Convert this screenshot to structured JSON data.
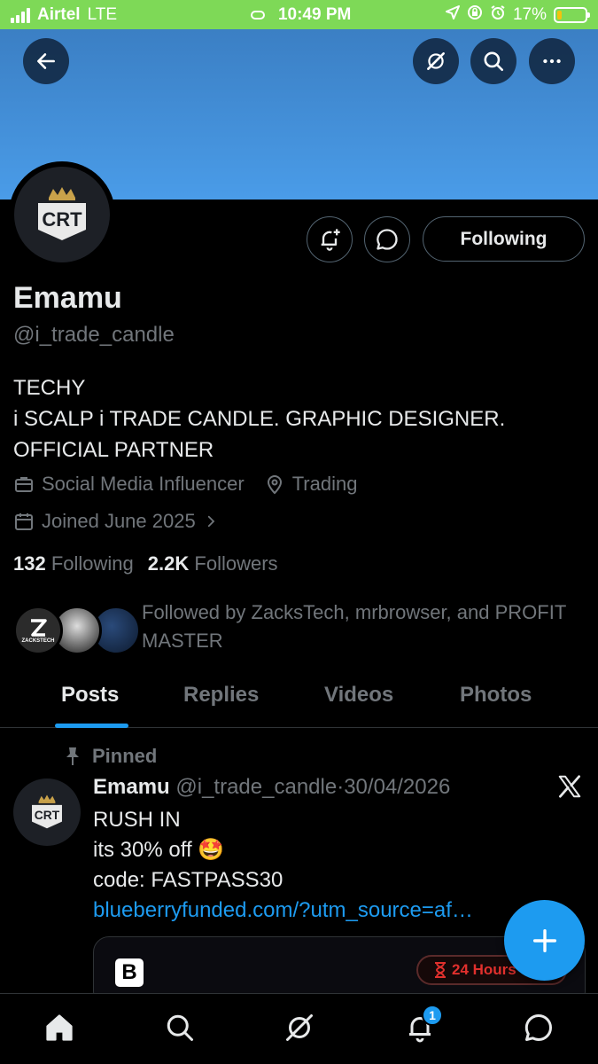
{
  "status_bar": {
    "carrier": "Airtel",
    "network": "LTE",
    "time": "10:49 PM",
    "battery_percent": "17%",
    "battery_level": 0.17,
    "background_color": "#7ed957"
  },
  "header": {
    "icons": [
      "back-arrow-icon",
      "grok-icon",
      "search-icon",
      "more-icon"
    ]
  },
  "profile": {
    "avatar_text": "CRT",
    "follow_label": "Following",
    "name": "Emamu",
    "handle": "@i_trade_candle",
    "bio_lines": [
      "TECHY",
      "i SCALP i TRADE CANDLE. GRAPHIC DESIGNER.",
      "OFFICIAL PARTNER"
    ],
    "category": "Social Media Influencer",
    "location": "Trading",
    "joined": "Joined June 2025",
    "following_count": "132",
    "following_label": "Following",
    "followers_count": "2.2K",
    "followers_label": "Followers",
    "followed_by": "Followed by ZacksTech, mrbrowser, and PROFIT MASTER",
    "followed_avatar_1_text": "ZACKSTECH"
  },
  "tabs": [
    {
      "label": "Posts",
      "active": true
    },
    {
      "label": "Replies",
      "active": false
    },
    {
      "label": "Videos",
      "active": false
    },
    {
      "label": "Photos",
      "active": false
    }
  ],
  "post": {
    "pinned_label": "Pinned",
    "author": "Emamu",
    "handle": "@i_trade_candle",
    "separator": "·",
    "date": "30/04/2026",
    "lines": [
      "RUSH IN",
      "its 30% off 🤩",
      "code: FASTPASS30"
    ],
    "link": "blueberryfunded.com/?utm_source=af…",
    "card_logo": "B",
    "card_badge": "24 Hours"
  },
  "bottom_nav": {
    "items": [
      "home-icon",
      "search-icon",
      "grok-icon",
      "notifications-icon",
      "messages-icon"
    ],
    "notification_count": "1"
  },
  "colors": {
    "accent": "#1d9bf0",
    "banner_top": "#3b7fc4",
    "banner_bottom": "#4a9ce8",
    "muted_text": "#71767b",
    "text": "#e7e9ea"
  }
}
